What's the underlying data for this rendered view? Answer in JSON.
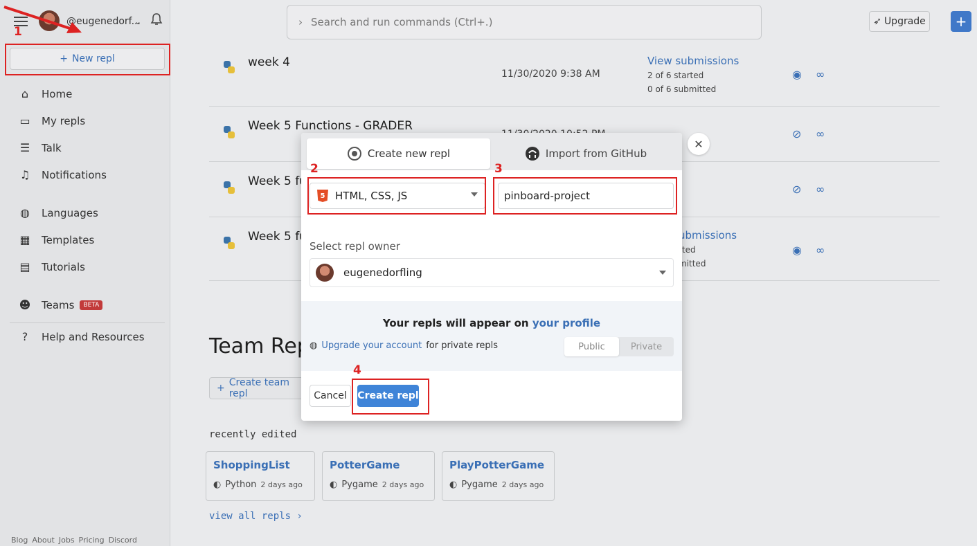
{
  "sidebar": {
    "username": "@eugenedorf...",
    "new_repl": "New repl",
    "items": [
      {
        "label": "Home",
        "icon": "home-icon"
      },
      {
        "label": "My repls",
        "icon": "folder-icon"
      },
      {
        "label": "Talk",
        "icon": "talk-icon"
      },
      {
        "label": "Notifications",
        "icon": "bell-icon"
      },
      {
        "label": "Languages",
        "icon": "globe-icon"
      },
      {
        "label": "Templates",
        "icon": "templates-icon"
      },
      {
        "label": "Tutorials",
        "icon": "book-icon"
      },
      {
        "label": "Teams",
        "icon": "people-icon",
        "badge": "BETA"
      },
      {
        "label": "Help and Resources",
        "icon": "question-icon"
      }
    ],
    "footer": [
      "Blog",
      "About",
      "Jobs",
      "Pricing",
      "Discord"
    ]
  },
  "topbar": {
    "search_placeholder": "Search and run commands (Ctrl+.)",
    "upgrade": "Upgrade"
  },
  "rows": [
    {
      "title": "week 4",
      "date": "11/30/2020 9:38 AM",
      "sub": "View submissions",
      "started": "2 of 6 started",
      "submitted": "0 of 6 submitted"
    },
    {
      "title": "Week 5 Functions - GRADER",
      "date": "11/30/2020 10:52 PM",
      "sub": "",
      "started": "",
      "submitted": ""
    },
    {
      "title": "Week 5 fu",
      "date": "",
      "sub": "",
      "started": "",
      "submitted": ""
    },
    {
      "title": "Week 5 fu",
      "date": "",
      "sub": "ubmissions",
      "started": "rted",
      "submitted": "mitted"
    }
  ],
  "team": {
    "heading": "Team Rep",
    "create": "Create team repl",
    "recent": "recently edited",
    "cards": [
      {
        "title": "ShoppingList",
        "lang": "Python",
        "when": "2 days ago"
      },
      {
        "title": "PotterGame",
        "lang": "Pygame",
        "when": "2 days ago"
      },
      {
        "title": "PlayPotterGame",
        "lang": "Pygame",
        "when": "2 days ago"
      }
    ],
    "view_all": "view all repls ›"
  },
  "modal": {
    "tab_new": "Create new repl",
    "tab_github": "Import from GitHub",
    "language": "HTML, CSS, JS",
    "name_value": "pinboard-project",
    "owner_label": "Select repl owner",
    "owner": "eugenedorfling",
    "appear_prefix": "Your repls will appear on",
    "appear_link": "your profile",
    "upgrade_link": "Upgrade your account",
    "upgrade_suffix": "for private repls",
    "toggle_public": "Public",
    "toggle_private": "Private",
    "cancel": "Cancel",
    "create": "Create repl"
  },
  "annotations": [
    "1",
    "2",
    "3",
    "4"
  ]
}
